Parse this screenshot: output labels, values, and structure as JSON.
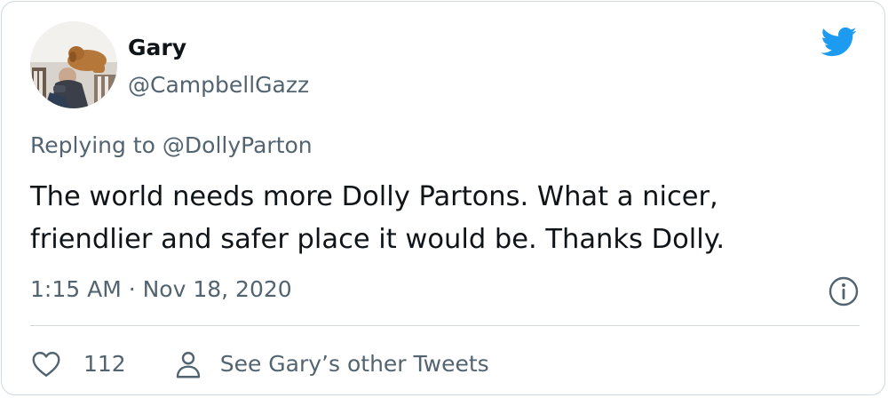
{
  "author": {
    "display_name": "Gary",
    "handle": "@CampbellGazz",
    "avatar_icon": "user-avatar-photo"
  },
  "brand": {
    "icon": "twitter-bird-icon",
    "color": "#1d9bf0"
  },
  "reply": {
    "prefix": "Replying to",
    "target": "@DollyParton"
  },
  "tweet": {
    "text": "The world needs more Dolly Partons. What a nicer, friendlier and safer place it would be. Thanks Dolly.",
    "timestamp": "1:15 AM · Nov 18, 2020"
  },
  "actions": {
    "like_icon": "heart-icon",
    "like_count": "112",
    "profile_icon": "person-icon",
    "other_tweets_label": "See Gary’s other Tweets"
  },
  "colors": {
    "text_primary": "#0f1419",
    "text_secondary": "#536471",
    "border": "#cfd9de"
  }
}
